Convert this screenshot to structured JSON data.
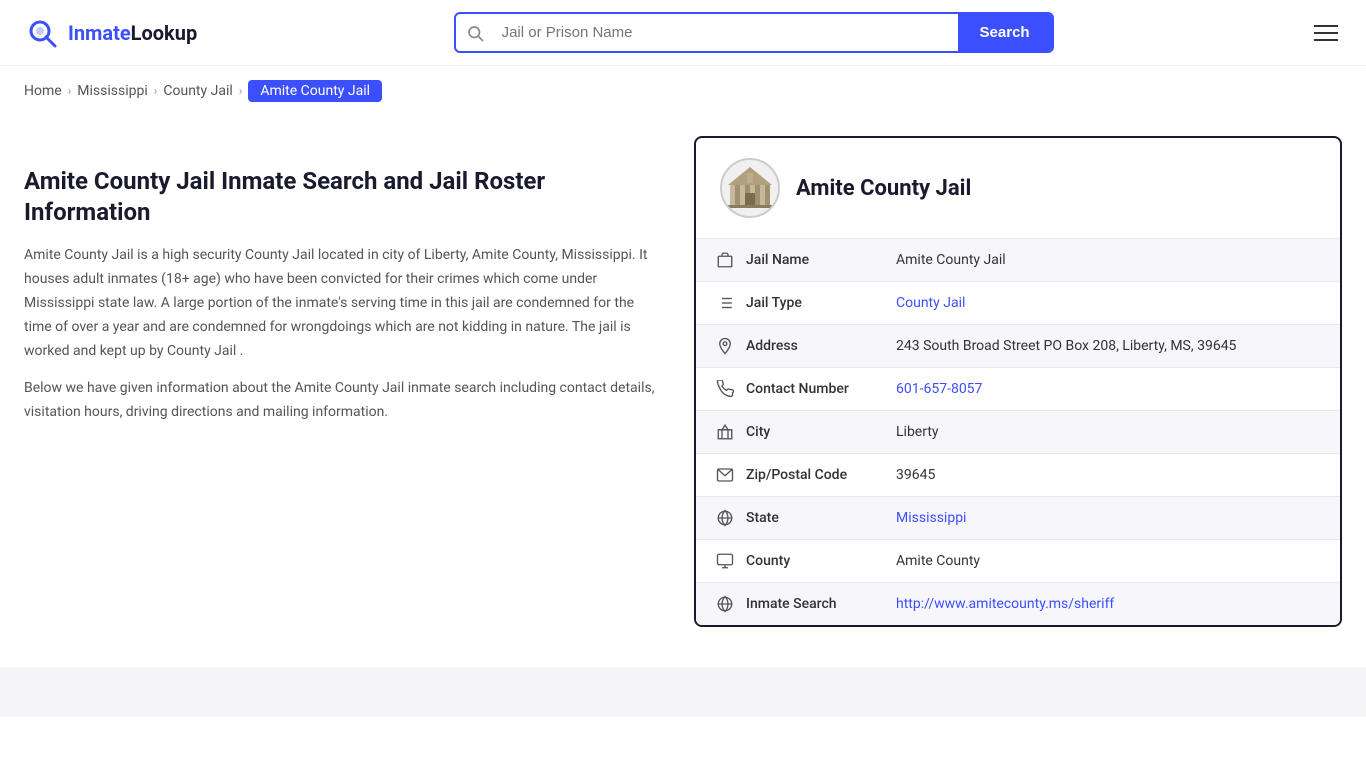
{
  "header": {
    "logo_brand": "InmateLookup",
    "logo_brand_part1": "Inmate",
    "logo_brand_part2": "Lookup",
    "search_placeholder": "Jail or Prison Name",
    "search_button_label": "Search",
    "menu_icon": "hamburger-menu"
  },
  "breadcrumb": {
    "items": [
      {
        "label": "Home",
        "href": "#"
      },
      {
        "label": "Mississippi",
        "href": "#"
      },
      {
        "label": "County Jail",
        "href": "#"
      },
      {
        "label": "Amite County Jail",
        "active": true
      }
    ]
  },
  "left": {
    "heading": "Amite County Jail Inmate Search and Jail Roster Information",
    "paragraph1": "Amite County Jail is a high security County Jail located in city of Liberty, Amite County, Mississippi. It houses adult inmates (18+ age) who have been convicted for their crimes which come under Mississippi state law. A large portion of the inmate's serving time in this jail are condemned for the time of over a year and are condemned for wrongdoings which are not kidding in nature. The jail is worked and kept up by County Jail .",
    "paragraph2": "Below we have given information about the Amite County Jail inmate search including contact details, visitation hours, driving directions and mailing information."
  },
  "jail_card": {
    "title": "Amite County Jail",
    "fields": [
      {
        "icon": "building-icon",
        "label": "Jail Name",
        "value": "Amite County Jail",
        "link": null
      },
      {
        "icon": "list-icon",
        "label": "Jail Type",
        "value": "County Jail",
        "link": "#"
      },
      {
        "icon": "location-icon",
        "label": "Address",
        "value": "243 South Broad Street PO Box 208, Liberty, MS, 39645",
        "link": null
      },
      {
        "icon": "phone-icon",
        "label": "Contact Number",
        "value": "601-657-8057",
        "link": "tel:601-657-8057"
      },
      {
        "icon": "city-icon",
        "label": "City",
        "value": "Liberty",
        "link": null
      },
      {
        "icon": "zip-icon",
        "label": "Zip/Postal Code",
        "value": "39645",
        "link": null
      },
      {
        "icon": "globe-icon",
        "label": "State",
        "value": "Mississippi",
        "link": "#"
      },
      {
        "icon": "county-icon",
        "label": "County",
        "value": "Amite County",
        "link": null
      },
      {
        "icon": "search-web-icon",
        "label": "Inmate Search",
        "value": "http://www.amitecounty.ms/sheriff",
        "link": "http://www.amitecounty.ms/sheriff"
      }
    ]
  },
  "colors": {
    "accent": "#3b4fff",
    "dark": "#1a1a2e"
  }
}
